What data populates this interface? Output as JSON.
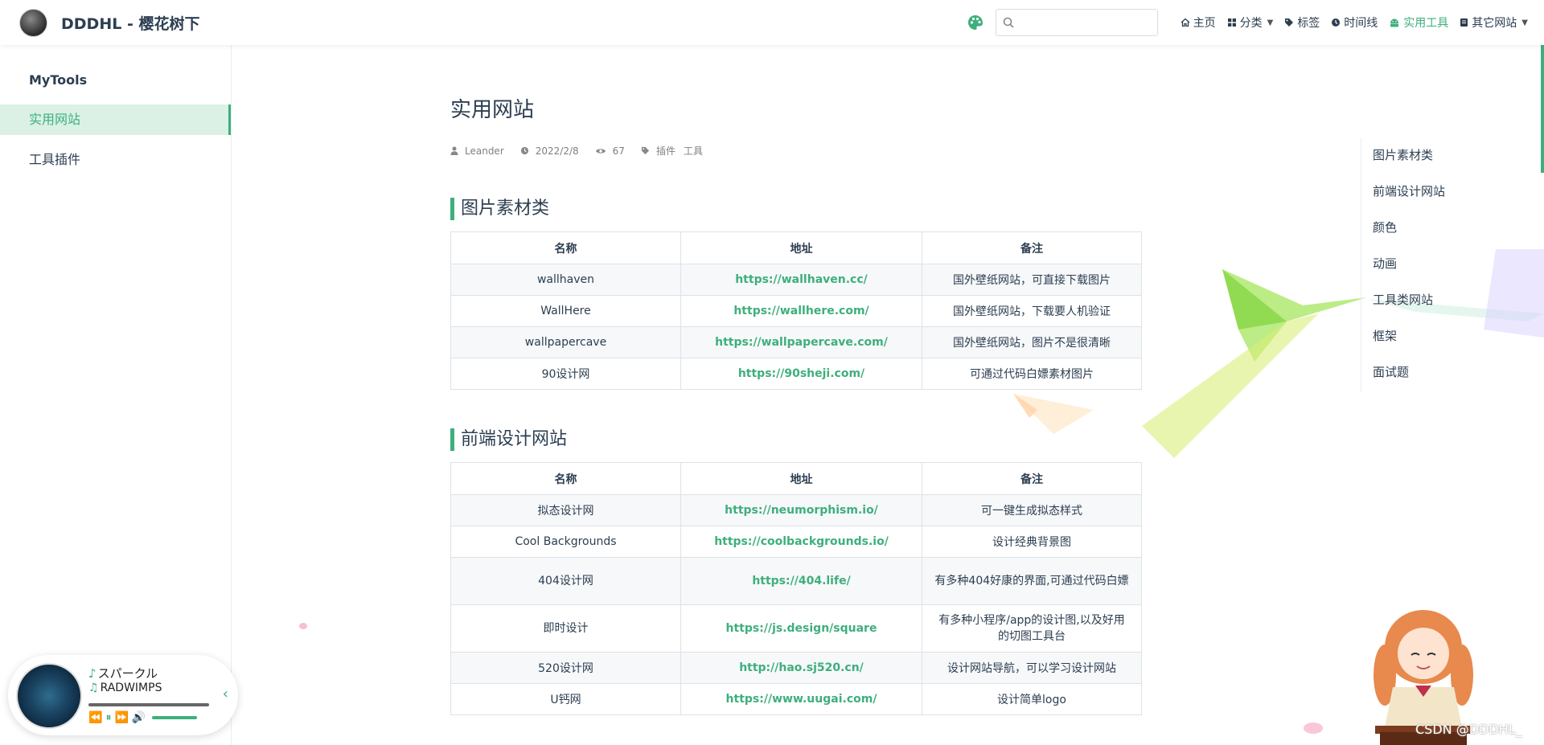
{
  "navbar": {
    "site_title": "DDDHL - 樱花树下",
    "search": {
      "value": "",
      "placeholder": ""
    },
    "items": [
      {
        "label": "主页",
        "icon": "home-icon"
      },
      {
        "label": "分类",
        "icon": "grid-icon"
      },
      {
        "label": "标签",
        "icon": "tag-icon"
      },
      {
        "label": "时间线",
        "icon": "clock-icon"
      },
      {
        "label": "实用工具",
        "icon": "android-icon"
      },
      {
        "label": "其它网站",
        "icon": "book-icon"
      }
    ],
    "active_item": "实用工具",
    "accent_color": "#3eaf7c"
  },
  "sidebar": {
    "heading": "MyTools",
    "items": [
      {
        "label": "实用网站",
        "active": true
      },
      {
        "label": "工具插件",
        "active": false
      }
    ]
  },
  "page": {
    "title": "实用网站",
    "meta": {
      "author": "Leander",
      "date": "2022/2/8",
      "views": "67",
      "tags": [
        "插件",
        "工具"
      ]
    },
    "sections": [
      {
        "title": "图片素材类",
        "headers": [
          "名称",
          "地址",
          "备注"
        ],
        "rows": [
          {
            "name": "wallhaven",
            "url": "https://wallhaven.cc/",
            "note": "国外壁纸网站，可直接下载图片"
          },
          {
            "name": "WallHere",
            "url": "https://wallhere.com/",
            "note": "国外壁纸网站，下载要人机验证"
          },
          {
            "name": "wallpapercave",
            "url": "https://wallpapercave.com/",
            "note": "国外壁纸网站，图片不是很清晰"
          },
          {
            "name": "90设计网",
            "url": "https://90sheji.com/",
            "note": "可通过代码白嫖素材图片"
          }
        ]
      },
      {
        "title": "前端设计网站",
        "headers": [
          "名称",
          "地址",
          "备注"
        ],
        "rows": [
          {
            "name": "拟态设计网",
            "url": "https://neumorphism.io/",
            "note": "可一键生成拟态样式"
          },
          {
            "name": "Cool Backgrounds",
            "url": "https://coolbackgrounds.io/",
            "note": "设计经典背景图"
          },
          {
            "name": "404设计网",
            "url": "https://404.life/",
            "note": "有多种404好康的界面,可通过代码白嫖"
          },
          {
            "name": "即时设计",
            "url": "https://js.design/square",
            "note": "有多种小程序/app的设计图,以及好用的切图工具台"
          },
          {
            "name": "520设计网",
            "url": "http://hao.sj520.cn/",
            "note": "设计网站导航，可以学习设计网站"
          },
          {
            "name": "U钙网",
            "url": "https://www.uugai.com/",
            "note": "设计简单logo"
          }
        ]
      }
    ]
  },
  "toc": [
    "图片素材类",
    "前端设计网站",
    "颜色",
    "动画",
    "工具类网站",
    "框架",
    "面试题"
  ],
  "player": {
    "song": "スパークル",
    "artist": "RADWIMPS"
  },
  "watermark": "CSDN @DDDHL_"
}
